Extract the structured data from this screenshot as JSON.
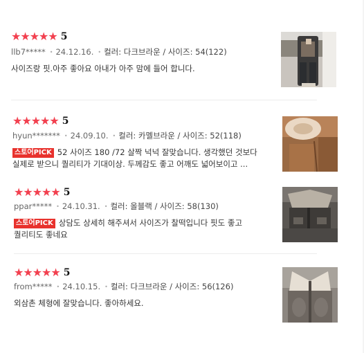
{
  "reviews": [
    {
      "stars": "★★★★★",
      "score": "5",
      "user": "llb7*****",
      "date": "24.12.16.",
      "option": "컬러: 다크브라운 / 사이즈: 54(122)",
      "badge": "",
      "text": "사이즈랑 핏.아주 좋아요 아내가 아주 맘에 들어 합니다.",
      "text2": ""
    },
    {
      "stars": "★★★★★",
      "score": "5",
      "user": "hyun*******",
      "date": "24.09.10.",
      "option": "컬러: 카멜브라운 / 사이즈: 52(118)",
      "badge": "스토어PICK",
      "text": "52 사이즈 180 /72 살짝 넉넉 잘맞습니다. 생각했던 것보다",
      "text2": "실제로 받으니 퀄리티가 기대이상. 두께감도 좋고 어깨도 넓어보이고 ..."
    },
    {
      "stars": "★★★★★",
      "score": "5",
      "user": "ppar*****",
      "date": "24.10.31.",
      "option": "컬러: 올블랙 / 사이즈: 58(130)",
      "badge": "스토어PICK",
      "text": "상담도 상세히 해주셔서 사이즈가 찰떡입니다 핏도 좋고",
      "text2": "퀄리티도 좋네요"
    },
    {
      "stars": "★★★★★",
      "score": "5",
      "user": "from*****",
      "date": "24.10.15.",
      "option": "컬러: 다크브라운 / 사이즈: 56(126)",
      "badge": "",
      "text": "외삼촌 체형에 잘맞습니다. 좋아하세요.",
      "text2": ""
    }
  ],
  "separator": "•",
  "colors": {
    "star": "#f2404f",
    "badge_bg": "#e8322d"
  }
}
